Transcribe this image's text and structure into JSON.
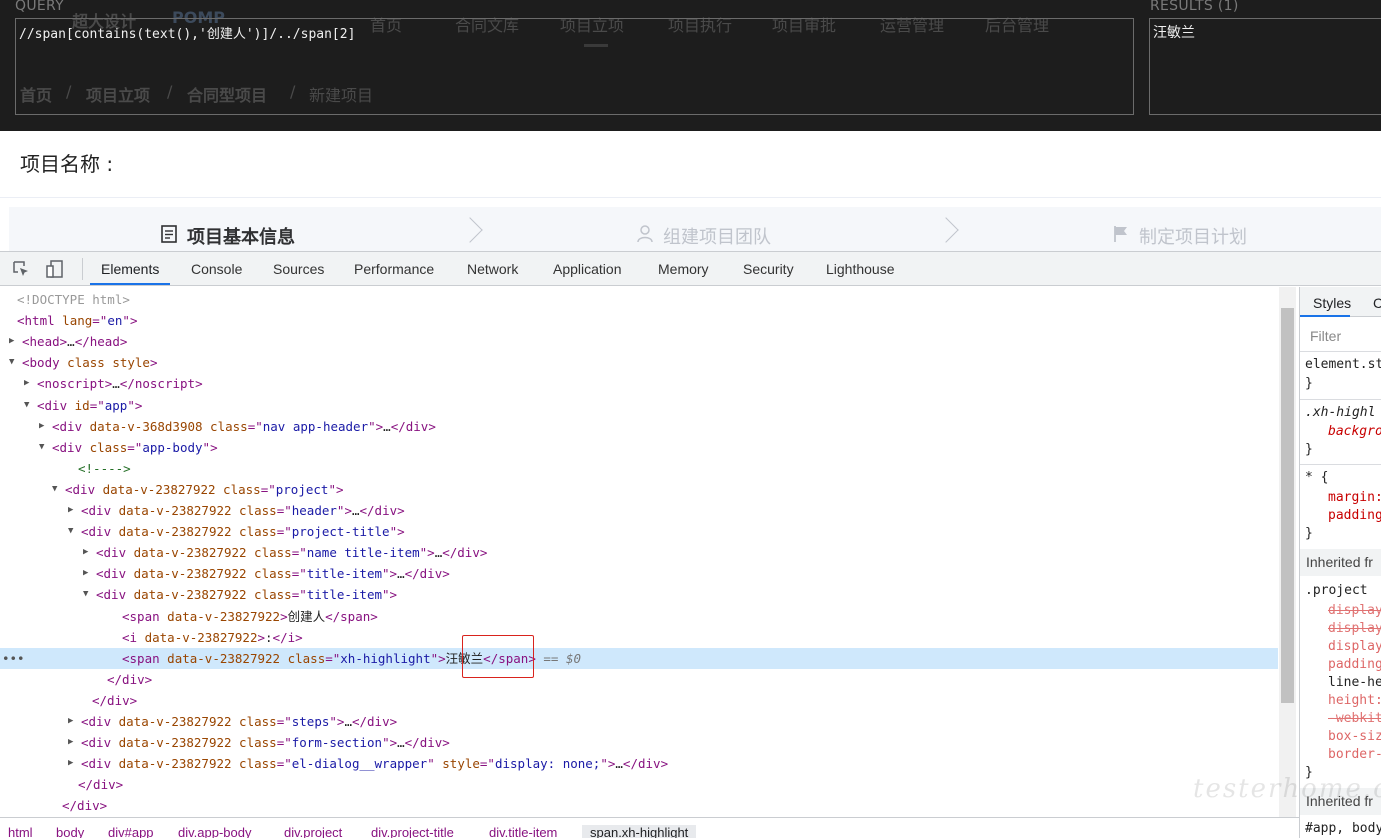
{
  "page_header": {
    "logo_text": "超大设计",
    "logo_brand": "POMP",
    "nav": [
      "首页",
      "合同文库",
      "项目立项",
      "项目执行",
      "项目审批",
      "运营管理",
      "后台管理"
    ],
    "breadcrumb": [
      "首页",
      "/",
      "项目立项",
      "/",
      "合同型项目",
      "/",
      "新建项目"
    ]
  },
  "xpath_helper": {
    "query_label": "QUERY",
    "query": "//span[contains(text(),'创建人')]/../span[2]",
    "results_label": "RESULTS (1)",
    "result": "汪敏兰"
  },
  "project": {
    "name_label": "项目名称 :",
    "steps": [
      "项目基本信息",
      "组建项目团队",
      "制定项目计划"
    ]
  },
  "devtools": {
    "tabs": [
      "Elements",
      "Console",
      "Sources",
      "Performance",
      "Network",
      "Application",
      "Memory",
      "Security",
      "Lighthouse"
    ],
    "active_tab": "Elements",
    "dom": [
      "<!DOCTYPE html>",
      "<html lang=\"en\">",
      "<head>…</head>",
      "<body class style>",
      "<noscript>…</noscript>",
      "<div id=\"app\">",
      "<div data-v-368d3908 class=\"nav app-header\">…</div>",
      "<div class=\"app-body\">",
      "<!---->",
      "<div data-v-23827922 class=\"project\">",
      "<div data-v-23827922 class=\"header\">…</div>",
      "<div data-v-23827922 class=\"project-title\">",
      "<div data-v-23827922 class=\"name title-item\">…</div>",
      "<div data-v-23827922 class=\"title-item\">…</div>",
      "<div data-v-23827922 class=\"title-item\">",
      "<span data-v-23827922>创建人</span>",
      "<i data-v-23827922>:</i>",
      "<span data-v-23827922 class=\"xh-highlight\">汪敏兰</span> == $0",
      "</div>",
      "</div>",
      "<div data-v-23827922 class=\"steps\">…</div>",
      "<div data-v-23827922 class=\"form-section\">…</div>",
      "<div data-v-23827922 class=\"el-dialog__wrapper\" style=\"display: none;\">…</div>",
      "</div>",
      "</div>"
    ],
    "selected_text": "汪敏兰",
    "selected_suffix": "== $0",
    "dots": "•••",
    "styles": {
      "tab_styles": "Styles",
      "tab_computed": "C",
      "filter": "Filter",
      "rules": [
        {
          "selector": "element.st",
          "props": [
            "}"
          ]
        },
        {
          "selector": ".xh-highl",
          "props": [
            "backgro",
            "}"
          ]
        },
        {
          "selector": "* {",
          "props": [
            "margin:",
            "padding",
            "}"
          ]
        }
      ],
      "inherited_from": "Inherited fr",
      "project_rule": ".project",
      "project_props": [
        "display",
        "display",
        "display",
        "padding",
        "line-he",
        "height:",
        "-webkit",
        "box-siz",
        "border-"
      ],
      "inherited_from_2": "Inherited fr",
      "last_rule": "#app, body"
    },
    "breadcrumbs": [
      "html",
      "body",
      "div#app",
      "div.app-body",
      "div.project",
      "div.project-title",
      "div.title-item",
      "span.xh-highlight"
    ]
  },
  "watermark": "testerhome.com"
}
